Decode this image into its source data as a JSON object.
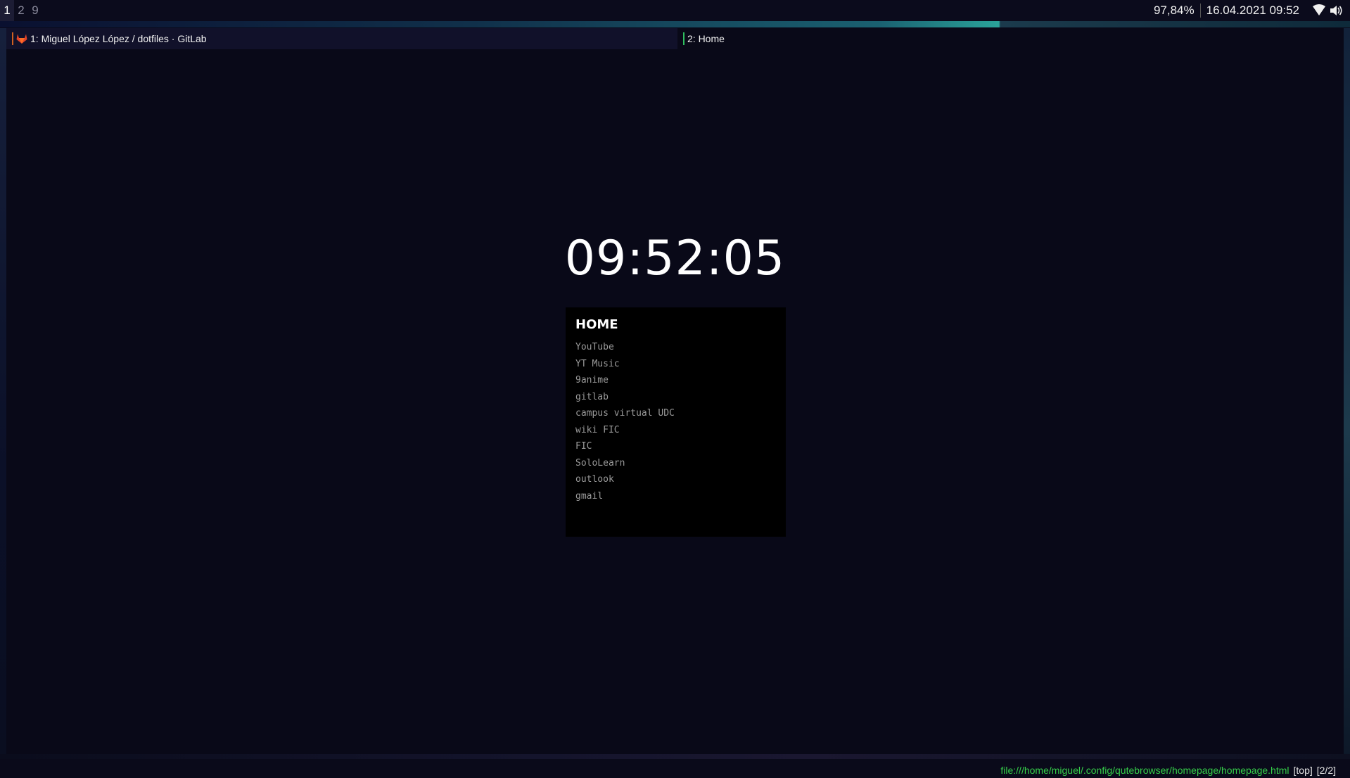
{
  "workspaces": [
    "1",
    "2",
    "9"
  ],
  "active_workspace": "1",
  "status": {
    "battery": "97,84%",
    "datetime": "16.04.2021 09:52",
    "wifi_icon": "wifi-icon",
    "volume_icon": "volume-icon"
  },
  "tabs": [
    {
      "label": "1: Miguel López López / dotfiles · GitLab",
      "icon": "gitlab-icon"
    },
    {
      "label": "2: Home"
    }
  ],
  "page": {
    "clock": "09:52:05",
    "home_title": "HOME",
    "links": [
      "YouTube",
      "YT Music",
      "9anime",
      "gitlab",
      "campus virtual UDC",
      "wiki FIC",
      "FIC",
      "SoloLearn",
      "outlook",
      "gmail"
    ]
  },
  "statusbar": {
    "url": "file:///home/miguel/.config/qutebrowser/homepage/homepage.html",
    "scroll": "[top]",
    "tab_index": "[2/2]"
  },
  "colors": {
    "background": "#0a0a1a",
    "url_green": "#36d04a",
    "accent_teal": "#2aa39a",
    "gitlab_orange": "#e24329"
  }
}
